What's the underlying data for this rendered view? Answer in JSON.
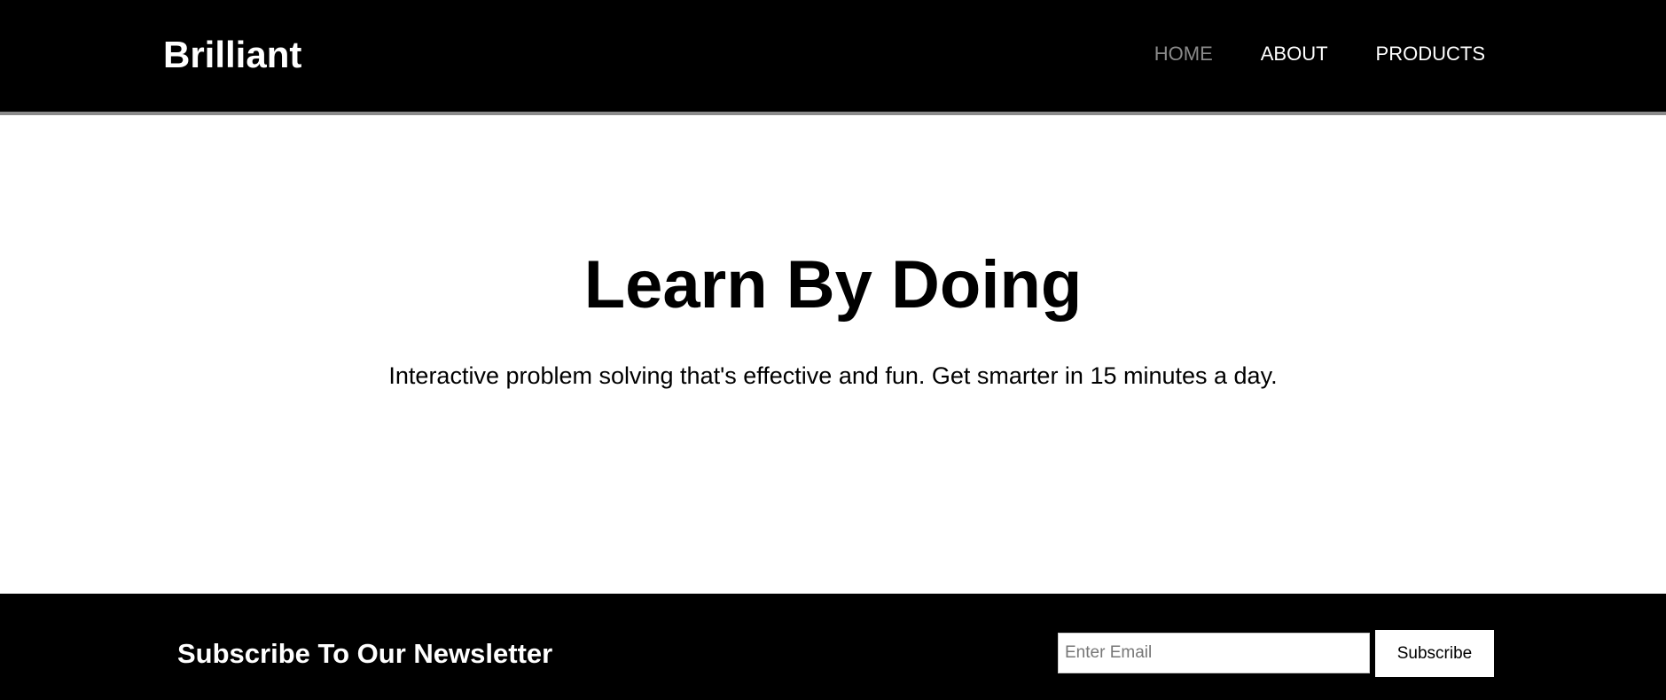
{
  "header": {
    "logo": "Brilliant",
    "nav": [
      {
        "label": "HOME",
        "active": true
      },
      {
        "label": "ABOUT",
        "active": false
      },
      {
        "label": "PRODUCTS",
        "active": false
      }
    ]
  },
  "hero": {
    "title": "Learn By Doing",
    "subtitle": "Interactive problem solving that's effective and fun. Get smarter in 15 minutes a day."
  },
  "footer": {
    "newsletter_title": "Subscribe To Our Newsletter",
    "email_placeholder": "Enter Email",
    "email_value": "",
    "subscribe_label": "Subscribe"
  },
  "colors": {
    "header_bg": "#000000",
    "header_border": "#8a8a8a",
    "nav_active": "#8a8a8a",
    "nav_default": "#ffffff",
    "page_bg": "#ffffff",
    "footer_bg": "#000000"
  }
}
